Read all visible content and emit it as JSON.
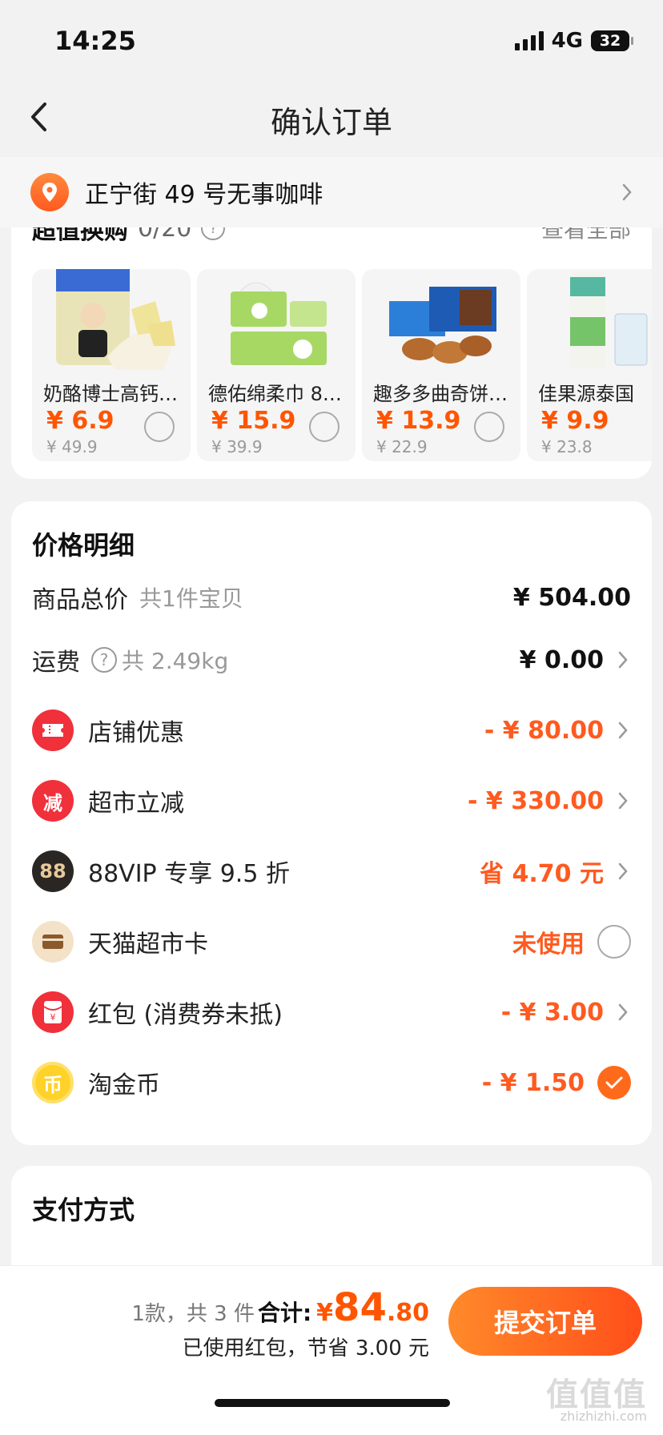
{
  "status": {
    "time": "14:25",
    "network": "4G",
    "battery": "32"
  },
  "nav": {
    "title": "确认订单"
  },
  "address": {
    "text": "正宁街 49 号无事咖啡"
  },
  "deals": {
    "title": "超值换购",
    "count": "0/20",
    "view_all": "查看全部",
    "items": [
      {
        "name": "奶酪博士高钙…",
        "price": "¥ 6.9",
        "orig": "¥ 49.9"
      },
      {
        "name": "德佑绵柔巾 8…",
        "price": "¥ 15.9",
        "orig": "¥ 39.9"
      },
      {
        "name": "趣多多曲奇饼…",
        "price": "¥ 13.9",
        "orig": "¥ 22.9"
      },
      {
        "name": "佳果源泰国",
        "price": "¥ 9.9",
        "orig": "¥ 23.8"
      }
    ]
  },
  "price_detail": {
    "title": "价格明细",
    "rows": [
      {
        "label": "商品总价",
        "sub": "共1件宝贝",
        "value": "¥ 504.00"
      },
      {
        "label": "运费",
        "sub": "共 2.49kg",
        "value": "¥ 0.00"
      },
      {
        "label": "店铺优惠",
        "value": "- ¥ 80.00",
        "icon": "ticket-icon"
      },
      {
        "label": "超市立减",
        "value": "- ¥ 330.00",
        "icon": "jian-icon",
        "icon_text": "减"
      },
      {
        "label": "88VIP 专享 9.5 折",
        "value": "省 4.70 元",
        "icon": "vip88-icon",
        "icon_text": "88"
      },
      {
        "label": "天猫超市卡",
        "value": "未使用",
        "icon": "card-icon"
      },
      {
        "label": "红包 (消费券未抵)",
        "value": "- ¥ 3.00",
        "icon": "red-packet-icon"
      },
      {
        "label": "淘金币",
        "value": "- ¥ 1.50",
        "icon": "coin-icon",
        "icon_text": "币"
      }
    ]
  },
  "payment": {
    "title": "支付方式"
  },
  "footer": {
    "count": "1款，共 3 件",
    "total_label": "合计:",
    "yen": "¥",
    "total_int": "84",
    "total_dec": ".80",
    "saved": "已使用红包，节省 3.00 元",
    "submit": "提交订单",
    "watermark": "值值值",
    "watermark_sub": "zhizhizhi.com"
  },
  "colors": {
    "accent": "#ff5a1f",
    "price": "#ff5500",
    "bg": "#f2f2f2"
  }
}
